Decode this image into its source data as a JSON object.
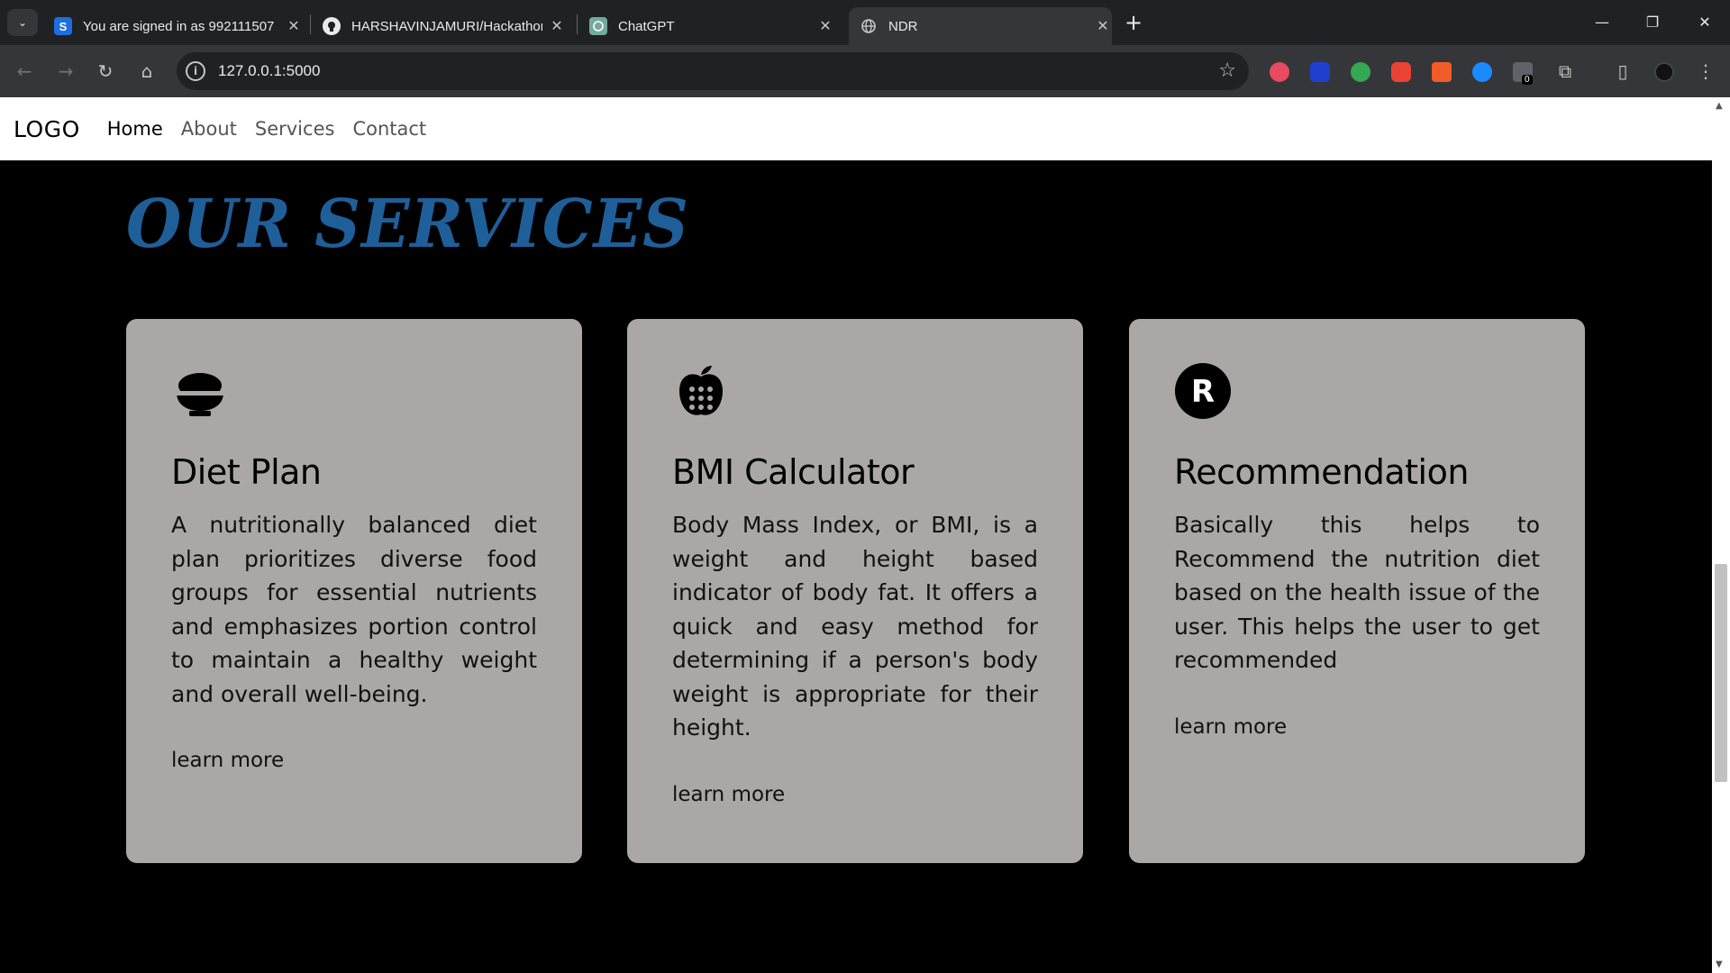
{
  "browser": {
    "tabs": [
      {
        "title": "You are signed in as 992111507",
        "favicon": "S"
      },
      {
        "title": "HARSHAVINJAMURI/Hackathon",
        "favicon": "github-icon"
      },
      {
        "title": "ChatGPT",
        "favicon": "chatgpt-icon"
      },
      {
        "title": "NDR",
        "favicon": "globe-icon"
      }
    ],
    "active_tab": 3,
    "url": "127.0.0.1:5000",
    "extension_badge": "0"
  },
  "nav": {
    "logo": "LOGO",
    "links": [
      "Home",
      "About",
      "Services",
      "Contact"
    ],
    "active": "Home"
  },
  "services": {
    "title": "OUR SERVICES",
    "cards": [
      {
        "icon": "rice-bowl-icon",
        "title": "Diet Plan",
        "description": "A nutritionally balanced diet plan prioritizes diverse food groups for essential nutrients and emphasizes portion control to maintain a healthy weight and overall well-being.",
        "link": "learn more"
      },
      {
        "icon": "apple-calculator-icon",
        "title": "BMI Calculator",
        "description": "Body Mass Index, or BMI, is a weight and height based indicator of body fat. It offers a quick and easy method for determining if a person's body weight is appropriate for their height.",
        "link": "learn more"
      },
      {
        "icon": "registered-r-icon",
        "title": "Recommendation",
        "description": "Basically this helps to Recommend the nutrition diet based on the health issue of the user. This helps the user to get recommended",
        "link": "learn more"
      }
    ]
  },
  "colors": {
    "title": "#1f5f99",
    "card_bg": "#aca7a7",
    "page_bg": "#000000"
  }
}
